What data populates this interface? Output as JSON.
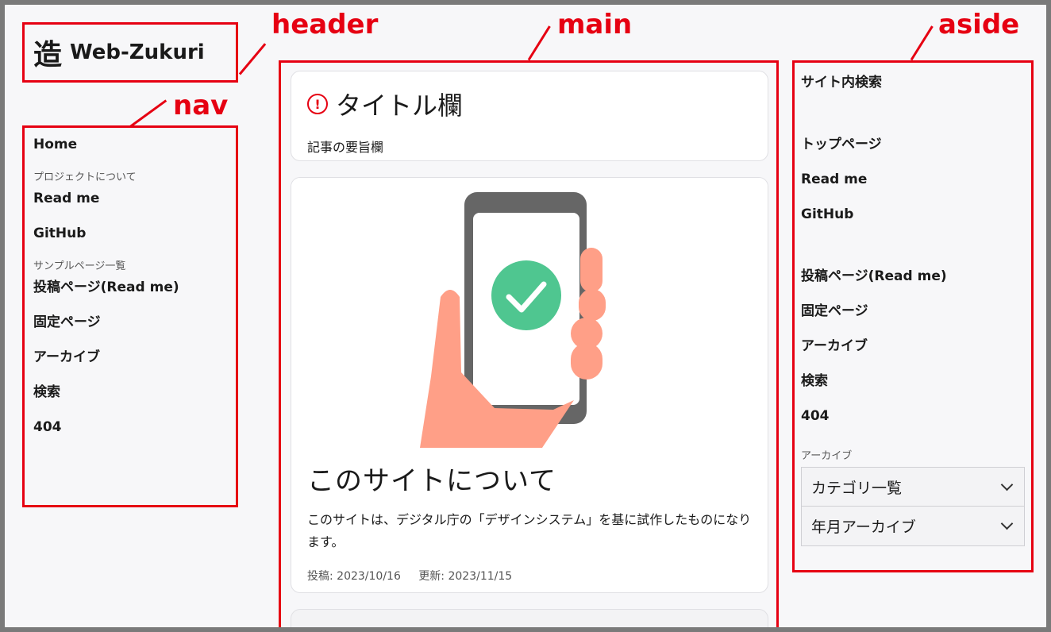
{
  "annotations": {
    "header": "header",
    "nav": "nav",
    "main": "main",
    "aside": "aside"
  },
  "header": {
    "logo_mark": "造",
    "site_name": "Web-Zukuri"
  },
  "nav": {
    "home": "Home",
    "group1_label": "プロジェクトについて",
    "group1_items": [
      "Read me",
      "GitHub"
    ],
    "group2_label": "サンプルページ一覧",
    "group2_items": [
      "投稿ページ(Read me)",
      "固定ページ",
      "アーカイブ",
      "検索",
      "404"
    ]
  },
  "main": {
    "title": "タイトル欄",
    "alert_icon": "alert-circle-icon",
    "summary": "記事の要旨欄",
    "article": {
      "title": "このサイトについて",
      "description": "このサイトは、デジタル庁の「デザインシステム」を基に試作したものになります。",
      "posted": "投稿: 2023/10/16",
      "updated": "更新: 2023/11/15",
      "image_icon": "phone-check-illustration"
    }
  },
  "aside": {
    "search_heading": "サイト内検索",
    "group1_items": [
      "トップページ",
      "Read me",
      "GitHub"
    ],
    "group2_items": [
      "投稿ページ(Read me)",
      "固定ページ",
      "アーカイブ",
      "検索",
      "404"
    ],
    "archive_label": "アーカイブ",
    "selects": [
      "カテゴリ一覧",
      "年月アーカイブ"
    ]
  },
  "colors": {
    "annotation_red": "#e60012",
    "check_green": "#4fc690",
    "hand_skin": "#ff9f87",
    "phone_gray": "#666666"
  }
}
